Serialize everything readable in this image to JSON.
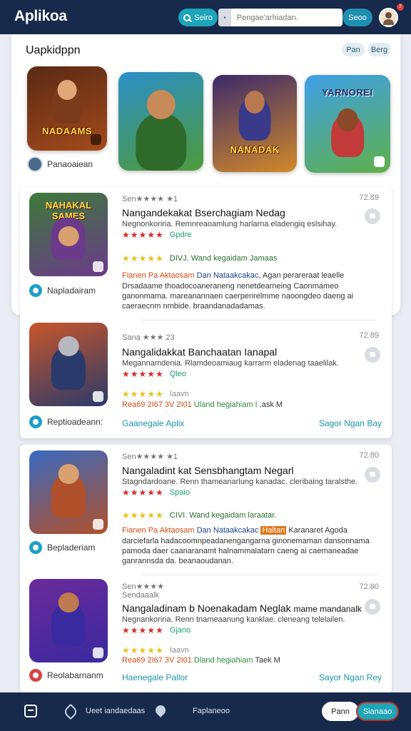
{
  "header": {
    "title": "Aplikoa",
    "search_button": "Seiro",
    "search_placeholder": "Pengae'arhiadan.",
    "go_button": "Seoo",
    "notification_count": "2"
  },
  "featured": {
    "title": "Uapkidppn",
    "chips": [
      "Pan",
      "Berg"
    ],
    "thumbnails": [
      {
        "logo": "NADAAMS",
        "colors": [
          "#5a2a14",
          "#a34a1c"
        ]
      },
      {
        "logo": "",
        "colors": [
          "#2b8fc8",
          "#4f9a3a"
        ]
      },
      {
        "logo": "NANADAK",
        "colors": [
          "#3b2a6a",
          "#d2892a"
        ]
      },
      {
        "logo": "YARNOREI",
        "colors": [
          "#3fa0e8",
          "#5fb04a"
        ]
      }
    ],
    "creator": "Panaoaiean"
  },
  "cards": [
    {
      "entries": [
        {
          "icon_title": "NAHAKAL SAMES",
          "icon_colors": [
            "#3d7a3a",
            "#6b3a8a"
          ],
          "source": "Napladairam",
          "meta": "Sen★★★★ ★1",
          "time": "72.89",
          "headline": "Nangandekakat Bserchagiam Nedag",
          "desc": "Negnonkoriria. Remnreaoamlung harlarna eladengiq eslsihay.",
          "red_label": "Gpdre",
          "yellow_label": "DIVJ. Wand kegaidam Jamaas",
          "line_orange": "Fianen Pa Aktaosam",
          "line_blue": "Dan Nataakcakac",
          "line_dark": "Agan perareraat leaelle",
          "body": "Drsadaame thoadocoaneraneng nenetdearneing Caonmameo ganonmama. mareanannaen caerpenrelmme naoongdeo daeng ai caeraecnm nmbide. braandanadadamas."
        },
        {
          "icon_title": "",
          "icon_colors": [
            "#c8562a",
            "#2a3a6a"
          ],
          "source": "Reptioadeann:",
          "meta": "Sana ★★★ 23",
          "time": "72.89",
          "headline": "Nangalidakkat Banchaatan Ianapal",
          "desc": "Megannamdenia. Rlamdeoamiaug karrarm eladenag taaelilak.",
          "red_label": "Qleo",
          "yellow_label": "Iaavn",
          "stats_orange": "Rea69 2I67 3V 2I01",
          "stats_green": "Uland hegiahiam I",
          "stats_dark": ".ask M",
          "link_left": "Gaanegale Aplix",
          "link_right": "Sagor Ngan Bay"
        }
      ]
    },
    {
      "entries": [
        {
          "icon_title": "",
          "icon_colors": [
            "#3a6ac0",
            "#b0502a"
          ],
          "source": "Bepladeriam",
          "meta": "Sen★★★★ ★1",
          "time": "72.80",
          "headline": "Nangaladint kat Sensbhangtam Negarl",
          "desc": "Stagndardoane. Renn thameanarlung kanadac. cleribaing taralsthe.",
          "red_label": "Spaio",
          "yellow_label": "CIVI. Wand kegaidam laraatar.",
          "line_orange": "Fianen Pa Aktaosam",
          "line_blue": "Dan Nataakcakac",
          "line_hl": "Haltan",
          "line_dark": "Karanaret Agoda",
          "body": "darciefarla hadacoomnpeadanengangarna ginonemaman dansonnama pamoda daer caanaranamt halnammalatarn caeng ai caemaneadae ganrannsda da. beanaoudanan."
        },
        {
          "icon_title": "",
          "icon_colors": [
            "#6a2a9a",
            "#3a2aa0"
          ],
          "source": "Reolabarnanm",
          "meta": "Sen★★★★",
          "meta2": "Sendaaalk",
          "time": "72.80",
          "headline": "Nangaladinam b Noenakadam Neglak",
          "headline_extra": "mame mandanalk",
          "desc": "Negnankoriria. Renn tnameaanung kanklae. cleneang telelailen.",
          "red_label": "Gjano",
          "yellow_label": "Iaavn",
          "stats_orange": "Rea69 2I67 3V 2I01",
          "stats_green": "Dland hegiahiam",
          "stats_dark": "Taek M",
          "link_left": "Haenegale Pallor",
          "link_right": "Sayor Ngan Rey"
        }
      ]
    }
  ],
  "bottom_nav": {
    "label_1": "Ueet iandaedaas",
    "label_2": "Faplaneoo",
    "btn_white": "Pann",
    "btn_teal": "Sianaao"
  }
}
